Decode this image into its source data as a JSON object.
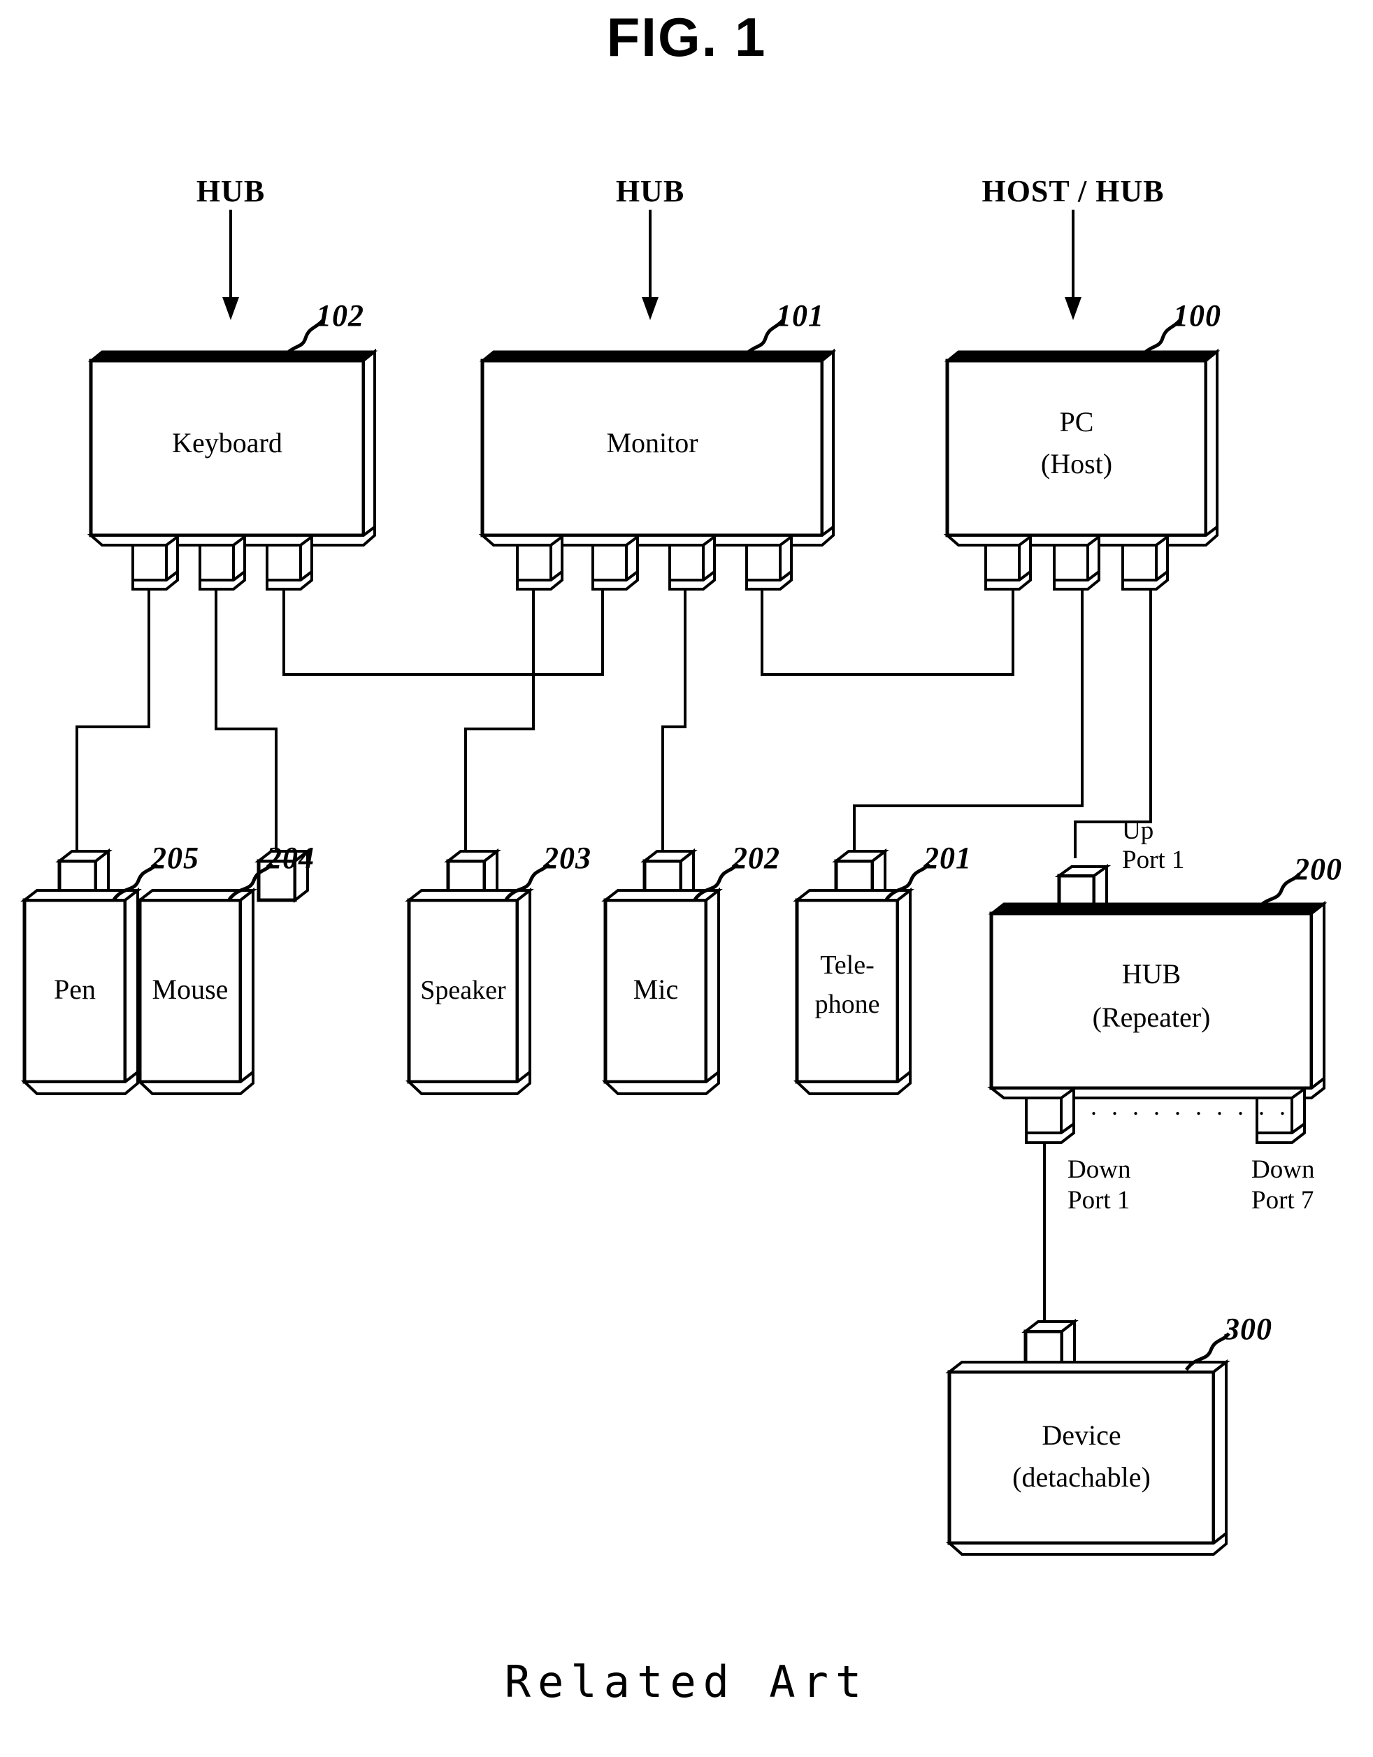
{
  "figure": {
    "title": "FIG. 1",
    "footer": "Related Art"
  },
  "annotations": {
    "hub_left": "HUB",
    "hub_mid": "HUB",
    "host_hub": "HOST / HUB"
  },
  "top_devices": [
    {
      "name": "keyboard",
      "label": "Keyboard",
      "sublabel": "",
      "ref": "102",
      "ports": 3
    },
    {
      "name": "monitor",
      "label": "Monitor",
      "sublabel": "",
      "ref": "101",
      "ports": 4
    },
    {
      "name": "pc",
      "label": "PC",
      "sublabel": "(Host)",
      "ref": "100",
      "ports": 3
    }
  ],
  "peripherals": [
    {
      "name": "pen",
      "label": "Pen",
      "sublabel": "",
      "ref": "205"
    },
    {
      "name": "mouse",
      "label": "Mouse",
      "sublabel": "",
      "ref": "204"
    },
    {
      "name": "speaker",
      "label": "Speaker",
      "sublabel": "",
      "ref": "203"
    },
    {
      "name": "mic",
      "label": "Mic",
      "sublabel": "",
      "ref": "202"
    },
    {
      "name": "telephone",
      "label": "Tele-",
      "sublabel": "phone",
      "ref": "201"
    }
  ],
  "hub": {
    "label": "HUB",
    "sublabel": "(Repeater)",
    "ref": "200",
    "up_port": "Up\nPort 1",
    "up_port_line1": "Up",
    "up_port_line2": "Port 1",
    "down_port_1_line1": "Down",
    "down_port_1_line2": "Port 1",
    "down_port_7_line1": "Down",
    "down_port_7_line2": "Port 7",
    "ellipsis": ". . . . . . . . . ."
  },
  "device": {
    "label": "Device",
    "sublabel": "(detachable)",
    "ref": "300"
  },
  "colors": {
    "ink": "#000000",
    "paper": "#ffffff"
  }
}
